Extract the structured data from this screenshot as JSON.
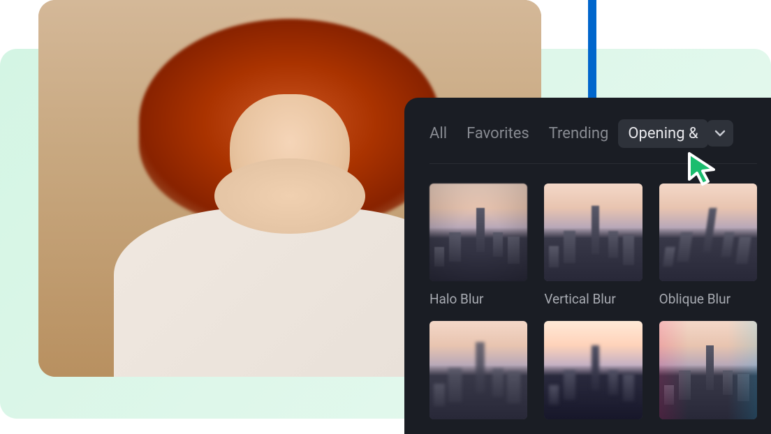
{
  "tabs": [
    {
      "label": "All",
      "active": false
    },
    {
      "label": "Favorites",
      "active": false
    },
    {
      "label": "Trending",
      "active": false
    },
    {
      "label": "Opening &",
      "active": true
    }
  ],
  "effects": [
    {
      "label": "Halo Blur",
      "style": "halo"
    },
    {
      "label": "Vertical Blur",
      "style": "vertical"
    },
    {
      "label": "Oblique Blur",
      "style": "oblique"
    },
    {
      "label": "",
      "style": "zoom"
    },
    {
      "label": "",
      "style": "mosaic"
    },
    {
      "label": "",
      "style": "glitch"
    }
  ],
  "colors": {
    "panel_bg": "#1a1d24",
    "mint_bg": "#d4f5e4",
    "accent_blue": "#0066cc",
    "cursor_green": "#1abd6e"
  }
}
